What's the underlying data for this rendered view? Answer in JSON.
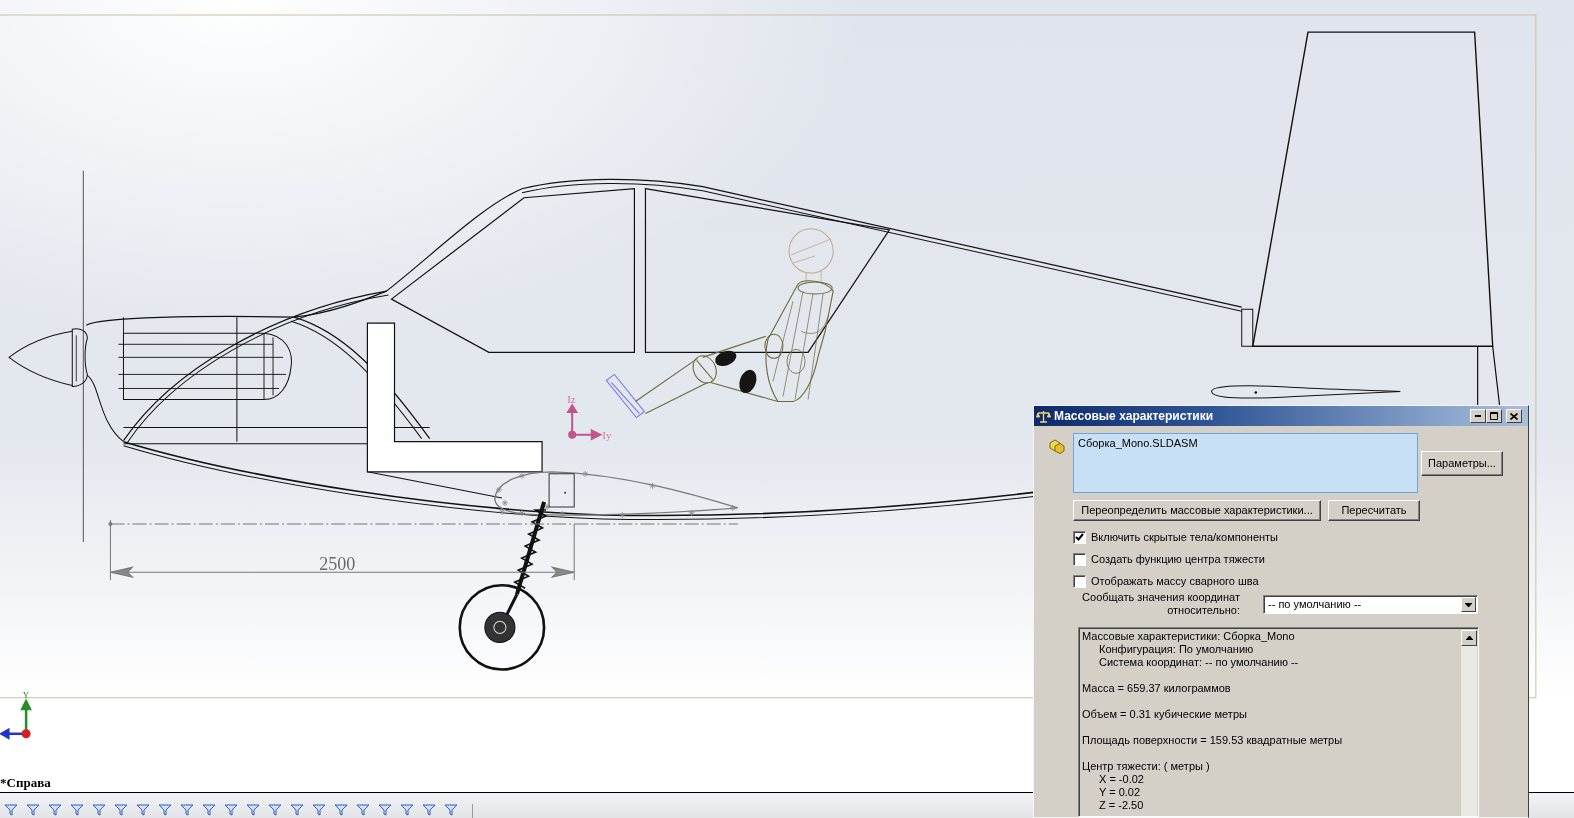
{
  "viewport": {
    "inertia_axes": {
      "z_label": "Iz",
      "y_label": "Iy"
    },
    "dimension": "2500",
    "triad": {
      "y_label": "Y"
    },
    "view_name": "*Справа"
  },
  "dialog": {
    "title": "Массовые характеристики",
    "selection": "Сборка_Mono.SLDASM",
    "options_button": "Параметры...",
    "action_buttons": [
      "Переопределить массовые характеристики...",
      "Пересчитать"
    ],
    "options": [
      {
        "label": "Включить скрытые тела/компоненты",
        "checked": true
      },
      {
        "label": "Создать функцию центра тяжести",
        "checked": false
      },
      {
        "label": "Отображать массу сварного шва",
        "checked": false
      }
    ],
    "coordinates_label": "Сообщать значения координат относительно:",
    "coordinates_value": "-- по умолчанию --",
    "results": [
      {
        "text": "Массовые характеристики: Сборка_Mono",
        "children": [
          {
            "text": "Конфигурация: По умолчанию"
          },
          {
            "text": "Система координат: -- по умолчанию --"
          }
        ]
      },
      {
        "text": "Масса = 659.37 килограммов"
      },
      {
        "text": "Объем = 0.31 кубические метры"
      },
      {
        "text": "Площадь поверхности = 159.53 квадратные метры"
      },
      {
        "text": "Центр тяжести: ( метры )",
        "children": [
          {
            "text": "X = -0.02"
          },
          {
            "text": "Y = 0.02"
          },
          {
            "text": "Z = -2.50"
          }
        ]
      }
    ]
  }
}
